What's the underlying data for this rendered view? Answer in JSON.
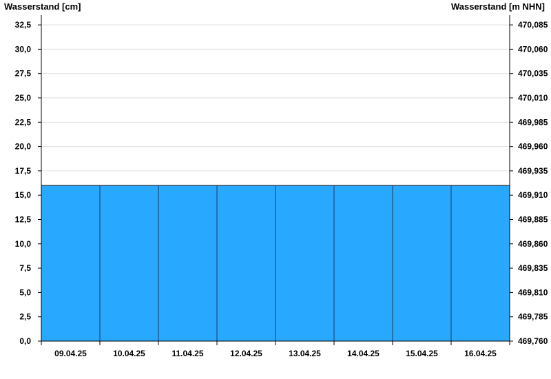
{
  "chart_data": {
    "type": "area",
    "ylabel_left": "Wasserstand [cm]",
    "ylabel_right": "Wasserstand [m NHN]",
    "ylim_left": [
      0,
      33.5
    ],
    "ylim_right": [
      469.76,
      470.095
    ],
    "y_ticks_left": [
      "0,0",
      "2,5",
      "5,0",
      "7,5",
      "10,0",
      "12,5",
      "15,0",
      "17,5",
      "20,0",
      "22,5",
      "25,0",
      "27,5",
      "30,0",
      "32,5"
    ],
    "y_ticks_right": [
      "469,760",
      "469,785",
      "469,810",
      "469,835",
      "469,860",
      "469,885",
      "469,910",
      "469,935",
      "469,960",
      "469,985",
      "470,010",
      "470,035",
      "470,060",
      "470,085"
    ],
    "categories": [
      "09.04.25",
      "10.04.25",
      "11.04.25",
      "12.04.25",
      "13.04.25",
      "14.04.25",
      "15.04.25",
      "16.04.25"
    ],
    "series": [
      {
        "values": [
          16,
          16,
          16,
          16,
          16,
          16,
          16,
          16
        ]
      }
    ],
    "fill_color": "#29A8FF",
    "grid": true
  }
}
